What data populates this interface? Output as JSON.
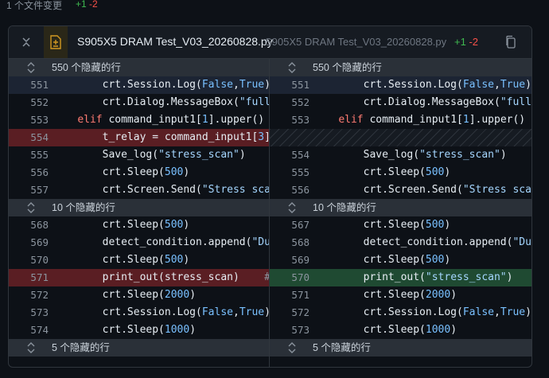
{
  "topbar": {
    "files_changed": "1 个文件变更",
    "additions": "+1",
    "deletions": "-2"
  },
  "file": {
    "name": "S905X5 DRAM Test_V03_20260828.py",
    "name_secondary": "S905X5 DRAM Test_V03_20260828.py",
    "additions": "+1",
    "deletions": "-2"
  },
  "hidden": {
    "h1": "550 个隐藏的行",
    "h2": "10 个隐藏的行",
    "h3": "5 个隐藏的行"
  },
  "left": {
    "rows": [
      {
        "num": "551",
        "pre": "        crt.Session.Log(",
        "kw1": "False",
        "mid": ",",
        "kw2": "True",
        "post": ")"
      },
      {
        "num": "552",
        "pre": "        crt.Dialog.MessageBox(",
        "str": "\"full"
      },
      {
        "num": "553",
        "pre": "    elif command_input1[",
        "n": "1",
        "post": "].upper() ="
      },
      {
        "num": "554",
        "pre": "        t_relay = command_input1[",
        "n": "3",
        "post": "]"
      },
      {
        "num": "555",
        "pre": "        Save_log(",
        "str": "\"stress_scan\"",
        "post": ")"
      },
      {
        "num": "556",
        "pre": "        crt.Sleep(",
        "n": "500",
        "post": ")"
      },
      {
        "num": "557",
        "pre": "        crt.Screen.Send(",
        "str": "\"Stress scan"
      },
      {
        "num": "568",
        "pre": "        crt.Sleep(",
        "n": "500",
        "post": ")"
      },
      {
        "num": "569",
        "pre": "        detect_condition.append(",
        "str": "\"Dur"
      },
      {
        "num": "570",
        "pre": "        crt.Sleep(",
        "n": "500",
        "post": ")"
      },
      {
        "num": "571",
        "pre": "        print_out(stress_scan)    ",
        "cm": "#"
      },
      {
        "num": "572",
        "pre": "        crt.Sleep(",
        "n": "2000",
        "post": ")"
      },
      {
        "num": "573",
        "pre": "        crt.Session.Log(",
        "kw1": "False",
        "mid": ",",
        "kw2": "True",
        "post": ")"
      },
      {
        "num": "574",
        "pre": "        crt.Sleep(",
        "n": "1000",
        "post": ")"
      }
    ]
  },
  "right": {
    "rows": [
      {
        "num": "551",
        "pre": "        crt.Session.Log(",
        "kw1": "False",
        "mid": ",",
        "kw2": "True",
        "post": ")"
      },
      {
        "num": "552",
        "pre": "        crt.Dialog.MessageBox(",
        "str": "\"full"
      },
      {
        "num": "553",
        "pre": "    elif command_input1[",
        "n": "1",
        "post": "].upper() ="
      },
      {
        "num": "554",
        "pre": "        Save_log(",
        "str": "\"stress_scan\"",
        "post": ")"
      },
      {
        "num": "555",
        "pre": "        crt.Sleep(",
        "n": "500",
        "post": ")"
      },
      {
        "num": "556",
        "pre": "        crt.Screen.Send(",
        "str": "\"Stress scan"
      },
      {
        "num": "567",
        "pre": "        crt.Sleep(",
        "n": "500",
        "post": ")"
      },
      {
        "num": "568",
        "pre": "        detect_condition.append(",
        "str": "\"Dur"
      },
      {
        "num": "569",
        "pre": "        crt.Sleep(",
        "n": "500",
        "post": ")"
      },
      {
        "num": "570",
        "pre": "        print_out(",
        "str": "\"stress_scan\"",
        "post": ")"
      },
      {
        "num": "571",
        "pre": "        crt.Sleep(",
        "n": "2000",
        "post": ")"
      },
      {
        "num": "572",
        "pre": "        crt.Session.Log(",
        "kw1": "False",
        "mid": ",",
        "kw2": "True",
        "post": ")"
      },
      {
        "num": "573",
        "pre": "        crt.Sleep(",
        "n": "1000",
        "post": ")"
      }
    ]
  },
  "icons": {
    "collapse": "collapse-icon",
    "file": "file-diff-icon",
    "copy": "copy-icon",
    "expand": "expand-icon"
  },
  "colors": {
    "deleted": "#5a1e23",
    "added": "#1f4a32",
    "accent_add": "#3fb950",
    "accent_del": "#f85149"
  }
}
